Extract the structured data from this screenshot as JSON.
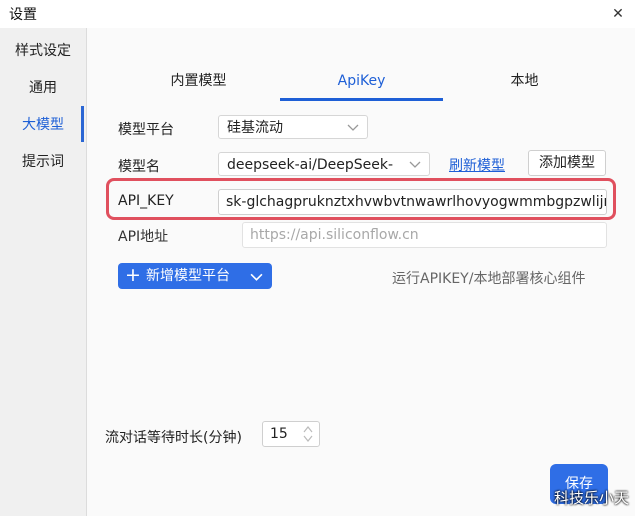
{
  "window": {
    "title": "设置",
    "close_glyph": "✕"
  },
  "sidebar": {
    "items": [
      {
        "label": "样式设定"
      },
      {
        "label": "通用"
      },
      {
        "label": "大模型"
      },
      {
        "label": "提示词"
      }
    ],
    "active_index": 2
  },
  "tabs": [
    {
      "label": "内置模型"
    },
    {
      "label": "ApiKey"
    },
    {
      "label": "本地"
    }
  ],
  "active_tab": 1,
  "form": {
    "platform_label": "模型平台",
    "platform_value": "硅基流动",
    "model_label": "模型名",
    "model_value": "deepseek-ai/DeepSeek-",
    "refresh_label": "刷新模型",
    "add_model_label": "添加模型",
    "api_key_label": "API_KEY",
    "api_key_value": "sk-glchagpruknztxhvwbvtnwawrlhovyogwmmbgpzwlijrsxl",
    "api_url_label": "API地址",
    "api_url_placeholder": "https://api.siliconflow.cn"
  },
  "add_platform_button": {
    "plus": "+",
    "label": "新增模型平台"
  },
  "hint_text": "运行APIKEY/本地部署核心组件",
  "wait_time": {
    "label": "流对话等待时长(分钟)",
    "value": "15"
  },
  "save_button": {
    "label": "保存"
  },
  "watermark": "科技乐小天",
  "colors": {
    "accent": "#1e5fd6",
    "highlight": "#e0505e",
    "primary_button": "#2f6ee6"
  }
}
